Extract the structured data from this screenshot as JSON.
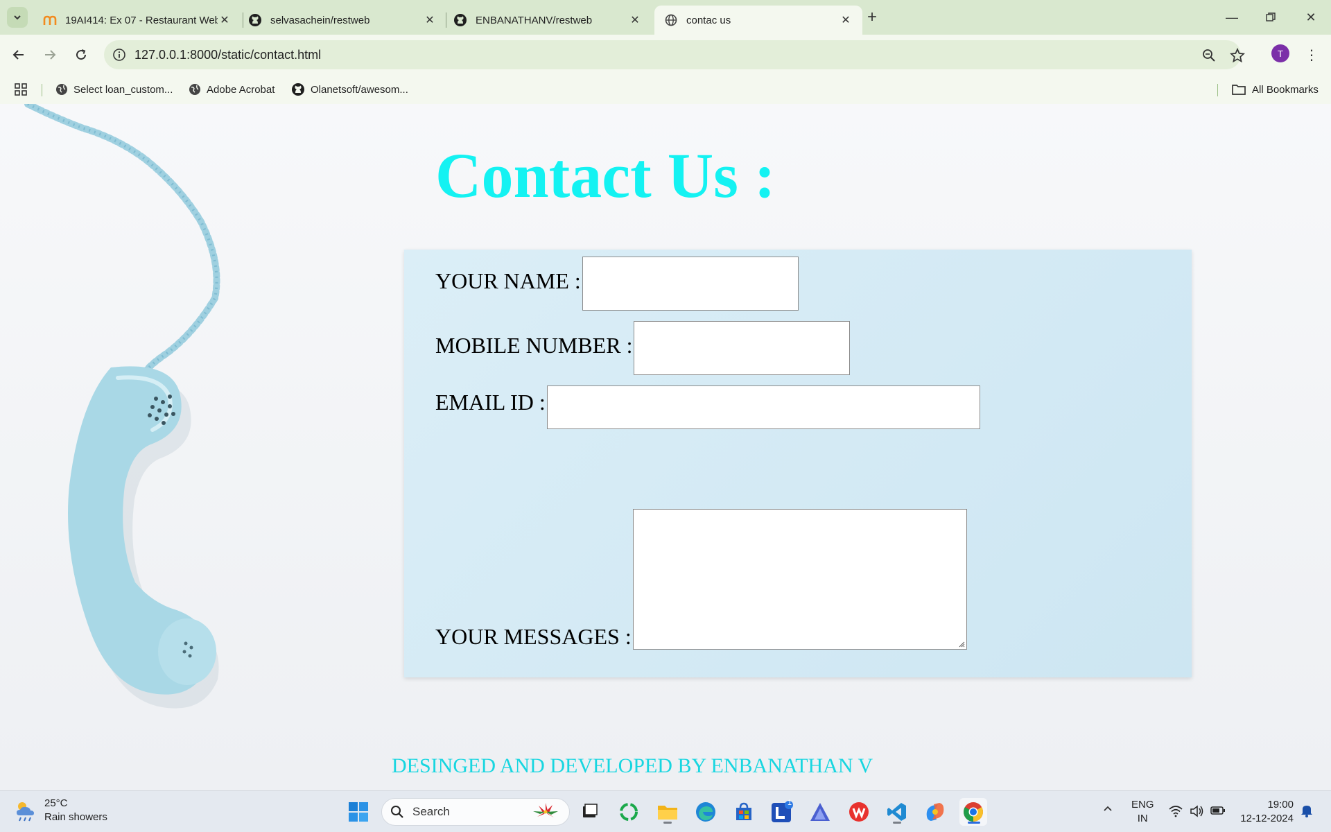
{
  "browser": {
    "tabs": [
      {
        "title": "19AI414: Ex 07 - Restaurant Web",
        "icon": "moodle-icon",
        "active": false
      },
      {
        "title": "selvasachein/restweb",
        "icon": "github-icon",
        "active": false
      },
      {
        "title": "ENBANATHANV/restweb",
        "icon": "github-icon",
        "active": false
      },
      {
        "title": "contac us",
        "icon": "globe-icon",
        "active": true
      }
    ],
    "url": "127.0.0.1:8000/static/contact.html",
    "avatar_letter": "T",
    "bookmarks": [
      "Select loan_custom...",
      "Adobe Acrobat",
      "Olanetsoft/awesom..."
    ],
    "all_bookmarks": "All Bookmarks"
  },
  "page": {
    "heading": "Contact Us :",
    "form": {
      "name_label": "YOUR NAME :",
      "mobile_label": "MOBILE NUMBER :",
      "email_label": "EMAIL ID :",
      "message_label": "YOUR MESSAGES :"
    },
    "footer": "DESINGED AND DEVELOPED BY ENBANATHAN V",
    "colors": {
      "heading": "#14f2f2",
      "footer": "#18d6e0",
      "card": "#d3eaf4"
    }
  },
  "taskbar": {
    "weather_temp": "25°C",
    "weather_desc": "Rain showers",
    "search_placeholder": "Search",
    "lang_top": "ENG",
    "lang_bottom": "IN",
    "time": "19:00",
    "date": "12-12-2024",
    "badge_count": "1"
  }
}
